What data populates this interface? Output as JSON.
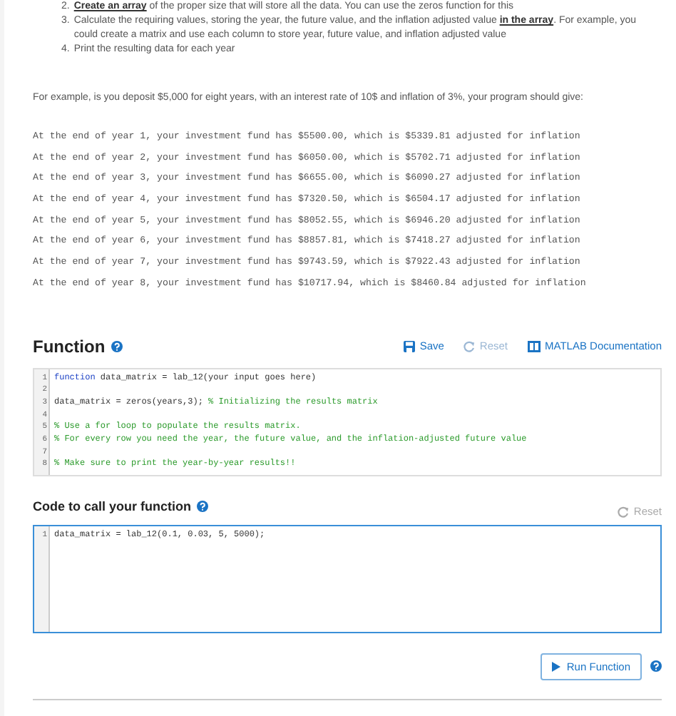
{
  "instructions": [
    {
      "number": "2.",
      "text": "**Create an array** of the proper size that will store all the data. You can use the zeros function for this"
    },
    {
      "number": "3.",
      "text": "Calculate the requiring values, storing the year, the future value, and the inflation adjusted value **in the array**. For example, you could create a matrix and use each column to store year, future value, and inflation adjusted value"
    },
    {
      "number": "4.",
      "text": "Print the resulting data for each year"
    }
  ],
  "example_intro": "For example, is you deposit $5,000 for eight years, with an interest rate of 10$ and inflation of 3%, your program should give:",
  "example_output": [
    "At the end of year 1, your investment fund has $5500.00, which is $5339.81 adjusted for inflation",
    "At the end of year 2, your investment fund has $6050.00, which is $5702.71 adjusted for inflation",
    "At the end of year 3, your investment fund has $6655.00, which is $6090.27 adjusted for inflation",
    "At the end of year 4, your investment fund has $7320.50, which is $6504.17 adjusted for inflation",
    "At the end of year 5, your investment fund has $8052.55, which is $6946.20 adjusted for inflation",
    "At the end of year 6, your investment fund has $8857.81, which is $7418.27 adjusted for inflation",
    "At the end of year 7, your investment fund has $9743.59, which is $7922.43 adjusted for inflation",
    "At the end of year 8, your investment fund has $10717.94, which is $8460.84 adjusted for inflation"
  ],
  "function_section": {
    "title": "Function",
    "save": "Save",
    "reset": "Reset",
    "docs": "MATLAB Documentation",
    "lines": [
      {
        "number": "1",
        "segments": [
          {
            "kind": "keyword",
            "text": "function"
          },
          {
            "kind": "code",
            "text": " data_matrix = lab_12(your input goes here)"
          }
        ]
      },
      {
        "number": "2"
      },
      {
        "number": "3",
        "segments": [
          {
            "kind": "code",
            "text": "data_matrix = zeros(years,3); "
          },
          {
            "kind": "comment",
            "text": "% Initializing the results matrix"
          }
        ]
      },
      {
        "number": "4"
      },
      {
        "number": "5",
        "segments": [
          {
            "kind": "comment",
            "text": "% Use a for loop to populate the results matrix."
          }
        ]
      },
      {
        "number": "6",
        "segments": [
          {
            "kind": "comment",
            "text": "% For every row you need the year, the future value, and the inflation-adjusted future value"
          }
        ]
      },
      {
        "number": "7"
      },
      {
        "number": "8",
        "segments": [
          {
            "kind": "comment",
            "text": "% Make sure to print the year-by-year results!!"
          }
        ]
      }
    ]
  },
  "call_section": {
    "title": "Code to call your function",
    "reset": "Reset",
    "lines": [
      {
        "number": "1",
        "segments": [
          {
            "kind": "code",
            "text": "data_matrix = lab_12(0.1, 0.03, 5, 5000);"
          }
        ]
      }
    ],
    "run": "Run Function"
  }
}
